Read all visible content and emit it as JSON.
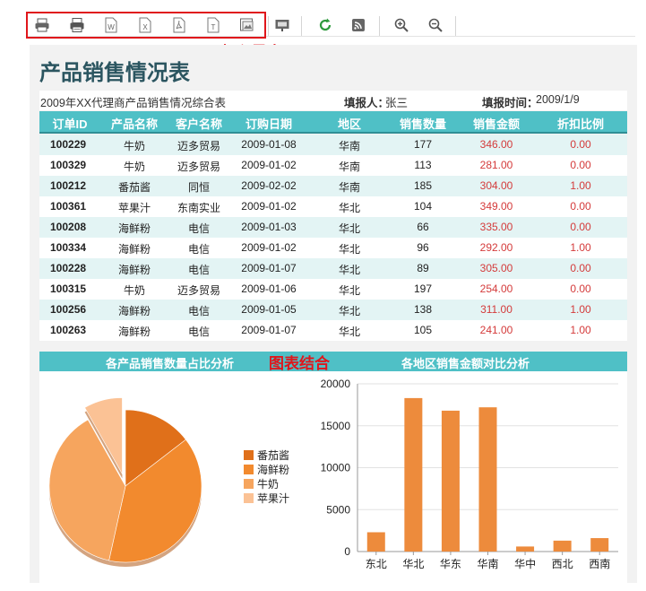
{
  "toolbar": {
    "buttons": [
      {
        "name": "print-icon",
        "label": ""
      },
      {
        "name": "print-alt-icon",
        "label": ""
      },
      {
        "name": "export-word-icon",
        "label": "W"
      },
      {
        "name": "export-excel-icon",
        "label": "X"
      },
      {
        "name": "export-pdf-icon",
        "label": ""
      },
      {
        "name": "export-text-icon",
        "label": "T"
      },
      {
        "name": "export-image-icon",
        "label": ""
      }
    ],
    "annotation_export": "打印导出"
  },
  "report": {
    "title": "产品销售情况表",
    "subtitle": "2009年XX代理商产品销售情况综合表",
    "reporter_label": "填报人：",
    "reporter_value": "张三",
    "time_label": "填报时间：",
    "time_value": "2009/1/9",
    "columns": [
      "订单ID",
      "产品名称",
      "客户名称",
      "订购日期",
      "地区",
      "销售数量",
      "销售金额",
      "折扣比例"
    ],
    "rows": [
      [
        "100229",
        "牛奶",
        "迈多贸易",
        "2009-01-08",
        "华南",
        "177",
        "346.00",
        "0.00"
      ],
      [
        "100329",
        "牛奶",
        "迈多贸易",
        "2009-01-02",
        "华南",
        "113",
        "281.00",
        "0.00"
      ],
      [
        "100212",
        "番茄酱",
        "同恒",
        "2009-02-02",
        "华南",
        "185",
        "304.00",
        "1.00"
      ],
      [
        "100361",
        "苹果汁",
        "东南实业",
        "2009-01-02",
        "华北",
        "104",
        "349.00",
        "0.00"
      ],
      [
        "100208",
        "海鲜粉",
        "电信",
        "2009-01-03",
        "华北",
        "66",
        "335.00",
        "0.00"
      ],
      [
        "100334",
        "海鲜粉",
        "电信",
        "2009-01-02",
        "华北",
        "96",
        "292.00",
        "1.00"
      ],
      [
        "100228",
        "海鲜粉",
        "电信",
        "2009-01-07",
        "华北",
        "89",
        "305.00",
        "0.00"
      ],
      [
        "100315",
        "牛奶",
        "迈多贸易",
        "2009-01-06",
        "华北",
        "197",
        "254.00",
        "0.00"
      ],
      [
        "100256",
        "海鲜粉",
        "电信",
        "2009-01-05",
        "华北",
        "138",
        "311.00",
        "1.00"
      ],
      [
        "100263",
        "海鲜粉",
        "电信",
        "2009-01-07",
        "华北",
        "105",
        "241.00",
        "1.00"
      ]
    ]
  },
  "charts_header": {
    "left_title": "各产品销售数量占比分析",
    "annotation": "图表结合",
    "right_title": "各地区销售金额对比分析"
  },
  "colors": {
    "header_teal": "#4fc0c6",
    "row_alt": "#e3f4f4",
    "annotation_red": "#e0161b",
    "title_color": "#2b5560",
    "bar_orange": "#ed8b3c"
  },
  "chart_data": [
    {
      "type": "pie",
      "title": "各产品销售数量占比分析",
      "labels": [
        "番茄酱",
        "海鲜粉",
        "牛奶",
        "苹果汁"
      ],
      "values": [
        185,
        494,
        487,
        104
      ],
      "colors": [
        "#e0701a",
        "#f28a2e",
        "#f6a55e",
        "#fbc295"
      ],
      "exploded": [
        "苹果汁"
      ],
      "legend": "right"
    },
    {
      "type": "bar",
      "title": "各地区销售金额对比分析",
      "categories": [
        "东北",
        "华北",
        "华东",
        "华南",
        "华中",
        "西北",
        "西南"
      ],
      "values": [
        2300,
        18300,
        16800,
        17200,
        600,
        1300,
        1600
      ],
      "ylim": [
        0,
        20000
      ],
      "yticks": [
        0,
        5000,
        10000,
        15000,
        20000
      ],
      "color": "#ed8b3c",
      "grid": true
    }
  ]
}
